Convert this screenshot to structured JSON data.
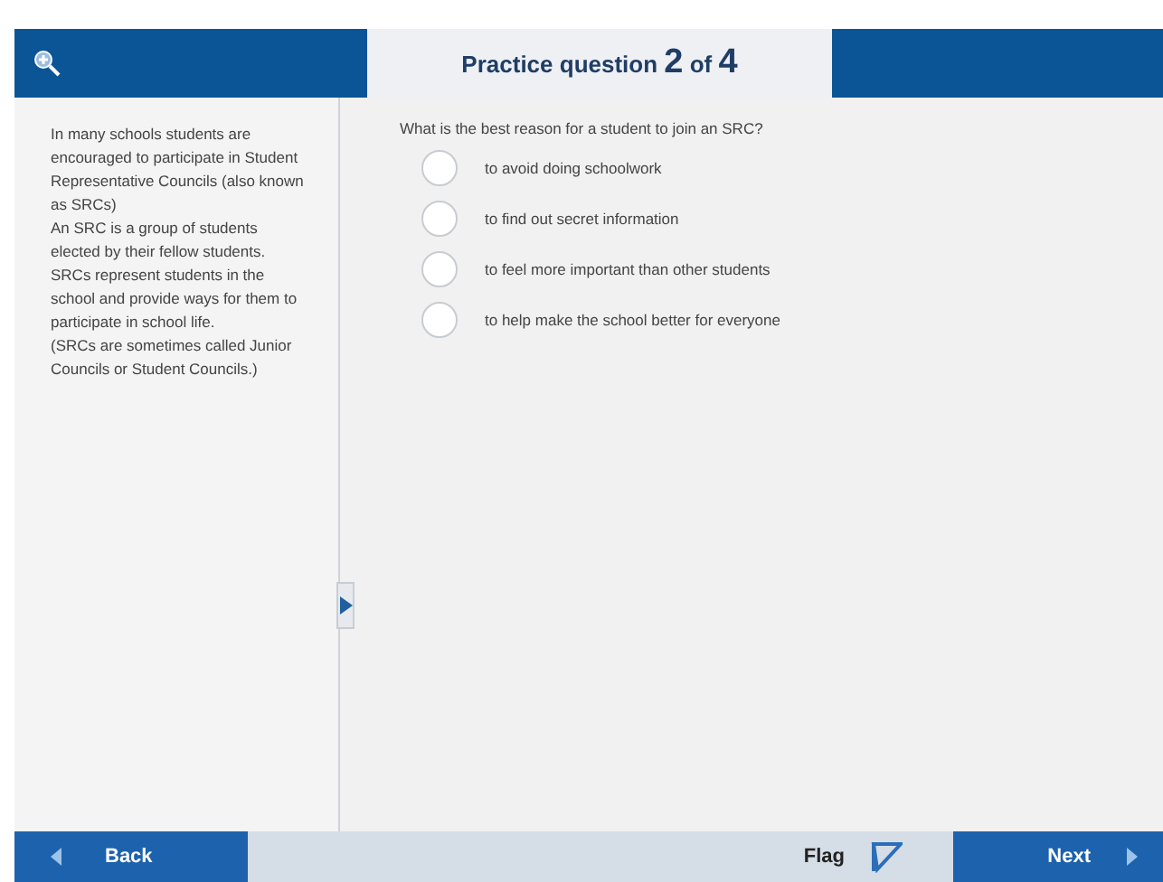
{
  "header": {
    "title": "Practice question",
    "current": "2",
    "of": "of",
    "total": "4"
  },
  "passage": [
    "In many schools students are encouraged to participate in Student Representative Councils (also known as SRCs)",
    "An SRC is a group of students elected by their fellow students.",
    "SRCs represent students in the school and provide ways for them to participate in school life.",
    "(SRCs are sometimes called Junior Councils or Student Councils.)"
  ],
  "question": "What is the best reason for a student to join an SRC?",
  "options": [
    {
      "label": "to avoid doing schoolwork",
      "selected": false
    },
    {
      "label": "to find out secret information",
      "selected": false
    },
    {
      "label": "to feel more important than other students",
      "selected": false
    },
    {
      "label": "to help make the school better for everyone",
      "selected": false
    }
  ],
  "footer": {
    "back": "Back",
    "flag": "Flag",
    "next": "Next"
  }
}
